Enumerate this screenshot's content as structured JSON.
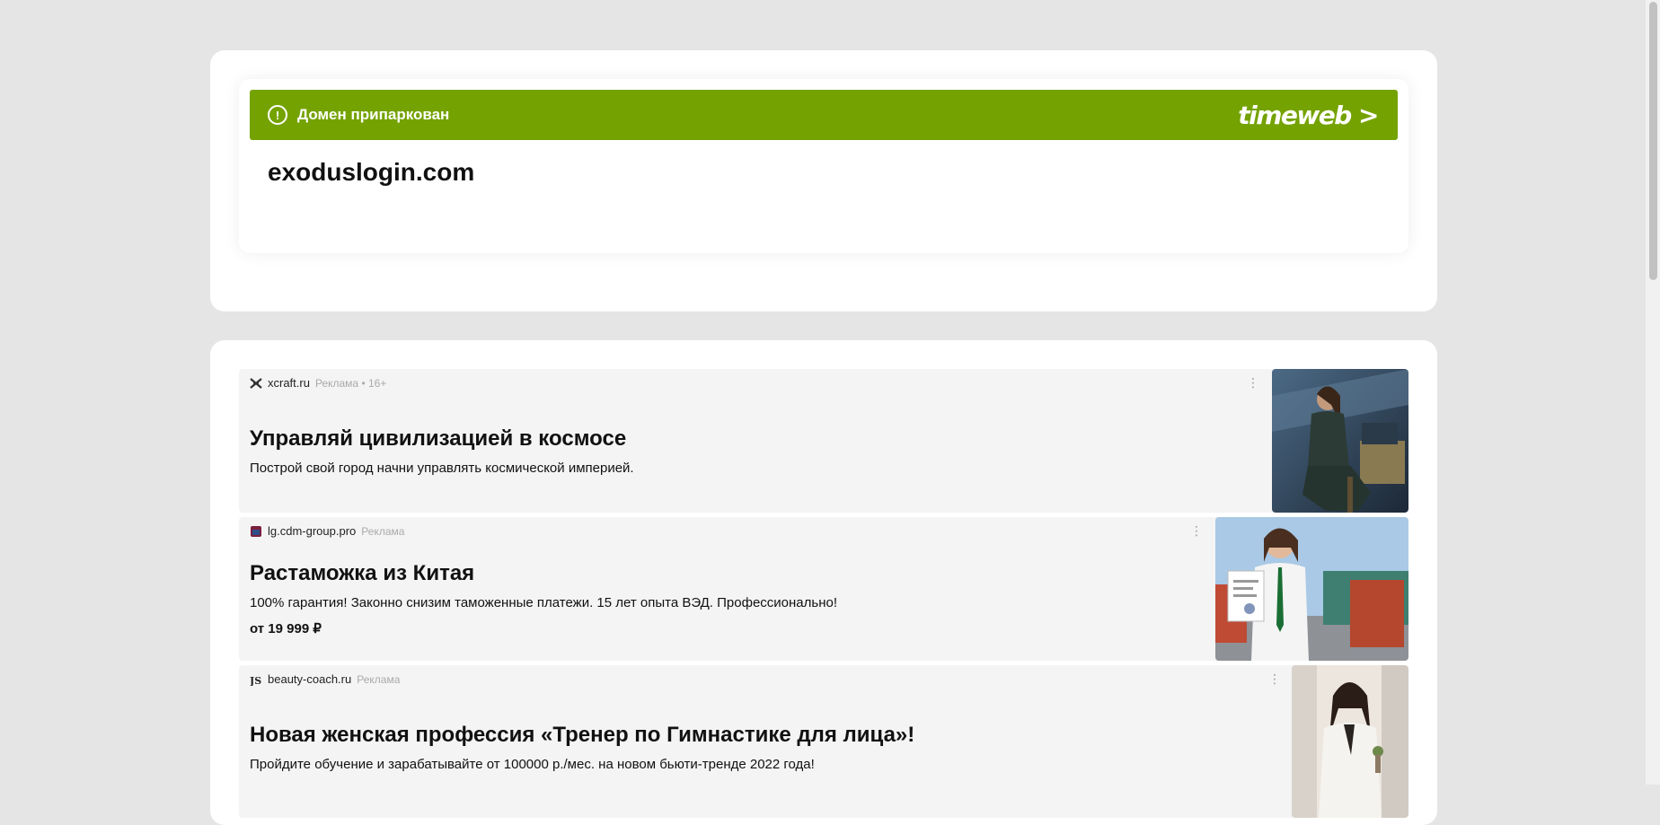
{
  "banner": {
    "status_text": "Домен припаркован",
    "brand": "timeweb >",
    "status_icon": "exclamation-circle-icon",
    "color": "#74a200"
  },
  "domain": "exoduslogin.com",
  "ads": [
    {
      "site": "xcraft.ru",
      "note": "Реклама • 16+",
      "title": "Управляй цивилизацией в космосе",
      "description": "Построй свой город начни управлять космической империей.",
      "price": ""
    },
    {
      "site": "lg.cdm-group.pro",
      "note": "Реклама",
      "title": "Растаможка из Китая",
      "description": "100% гарантия! Законно снизим таможенные платежи. 15 лет опыта ВЭД. Профессионально!",
      "price": "от 19 999 ₽"
    },
    {
      "site": "beauty-coach.ru",
      "note": "Реклама",
      "title": "Новая женская профессия «Тренер по Гимнастике для лица»!",
      "description": "Пройдите обучение и зарабатывайте от 100000 р./мес. на новом бьюти-тренде 2022 года!",
      "price": ""
    }
  ],
  "icons": {
    "favicon_1": "xcraft-favicon-icon",
    "favicon_2": "cdm-favicon-icon",
    "favicon_3": "js-favicon-icon",
    "menu": "kebab-menu-icon"
  }
}
